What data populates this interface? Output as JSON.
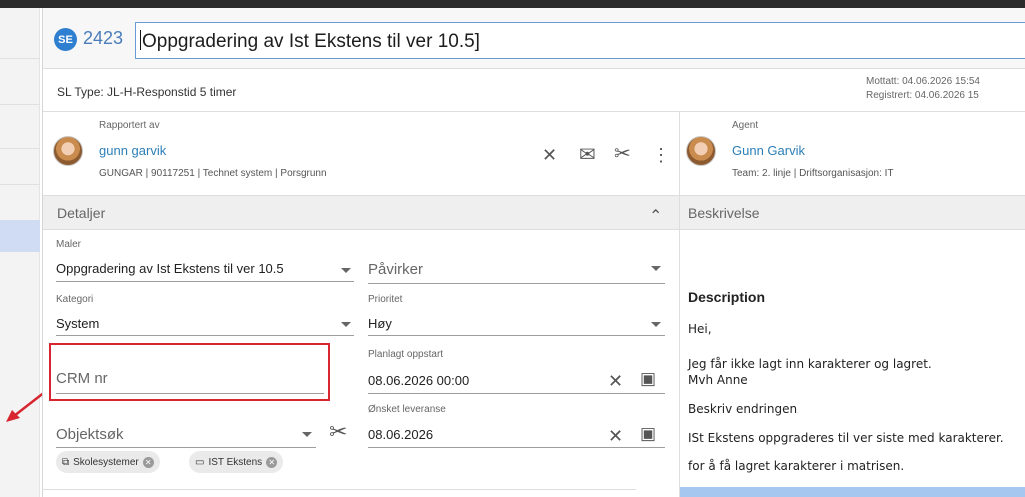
{
  "ticket": {
    "badge": "SE",
    "number": "2423",
    "title": "Oppgradering av  Ist Ekstens til ver 10.5]",
    "sl_type": "SL Type: JL-H-Responstid 5 timer",
    "mottatt": "Mottatt: 04.06.2026 15:54",
    "registrert": "Registrert: 04.06.2026 15"
  },
  "reporter": {
    "label": "Rapportert av",
    "name": "gunn garvik",
    "meta": "GUNGAR | 90117251 | Technet system | Porsgrunn"
  },
  "agent": {
    "label": "Agent",
    "name": "Gunn Garvik",
    "meta": "Team: 2. linje | Driftsorganisasjon: IT"
  },
  "icons": {
    "close": "✕",
    "mail": "✉",
    "tools": "✂",
    "more": "⋮",
    "chevron_up": "⌃",
    "calendar": "▣",
    "dropdown": "caret-down-icon"
  },
  "details": {
    "header": "Detaljer",
    "maler_label": "Maler",
    "maler_value": "Oppgradering av Ist Ekstens til ver 10.5",
    "pavirker_placeholder": "Påvirker",
    "kategori_label": "Kategori",
    "kategori_value": "System",
    "prioritet_label": "Prioritet",
    "prioritet_value": "Høy",
    "crm_placeholder": "CRM nr",
    "planlagt_label": "Planlagt oppstart",
    "planlagt_value": "08.06.2026 00:00",
    "onsket_label": "Ønsket leveranse",
    "onsket_value": "08.06.2026",
    "objektsok_placeholder": "Objektsøk",
    "chips": [
      {
        "icon": "⧉",
        "label": "Skolesystemer"
      },
      {
        "icon": "▭",
        "label": "IST Ekstens"
      }
    ]
  },
  "description": {
    "header": "Beskrivelse",
    "title": "Description",
    "lines": [
      "Hei,",
      "Jeg får ikke lagt inn karakterer og lagret.",
      "Mvh Anne",
      "Beskriv endringen",
      "ISt Ekstens oppgraderes til ver siste med karakterer.",
      "for å få lagret karakterer i matrisen."
    ]
  },
  "colors": {
    "accent": "#2c7fb8",
    "highlight_box": "#d7262f",
    "badge": "#2f7fd1"
  }
}
